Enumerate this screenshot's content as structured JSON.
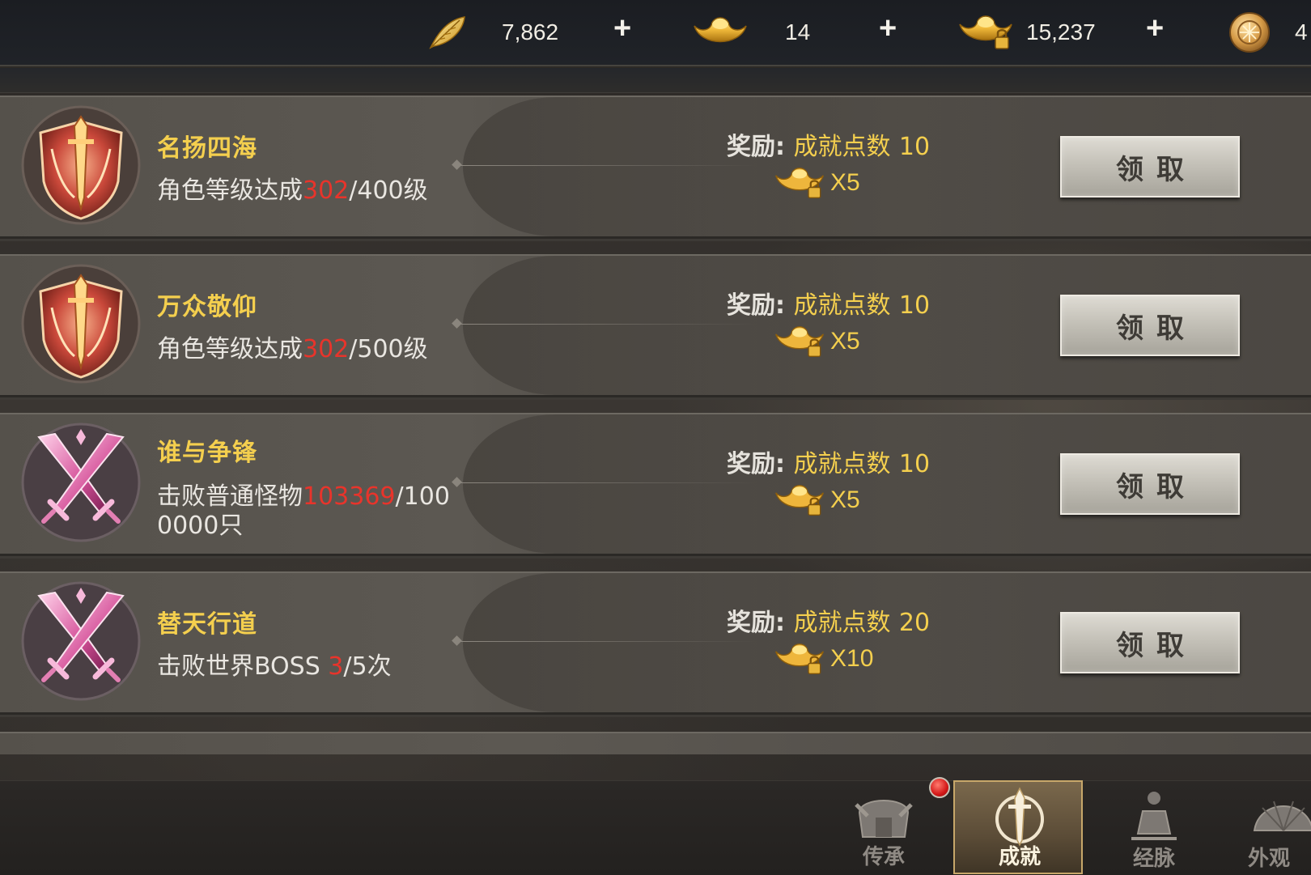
{
  "resources": [
    {
      "icon": "gold-feather-icon",
      "value": "7,862",
      "plus": "+"
    },
    {
      "icon": "gold-ingot-icon",
      "value": "14",
      "plus": "+"
    },
    {
      "icon": "locked-gold-ingot-icon",
      "value": "15,237",
      "plus": "+"
    },
    {
      "icon": "bronze-coin-icon",
      "value": "4"
    }
  ],
  "achievements": [
    {
      "title": "名扬四海",
      "desc_prefix": "角色等级达成",
      "progress": "302",
      "desc_suffix": "/400级",
      "reward_label": "奖励:",
      "reward_text": "成就点数",
      "reward_points": "10",
      "reward_item_icon": "locked-gold-ingot-icon",
      "reward_qty": "X5",
      "emblem": "red-sword-shield-emblem-icon",
      "button": "领取"
    },
    {
      "title": "万众敬仰",
      "desc_prefix": "角色等级达成",
      "progress": "302",
      "desc_suffix": "/500级",
      "reward_label": "奖励:",
      "reward_text": "成就点数",
      "reward_points": "10",
      "reward_item_icon": "locked-gold-ingot-icon",
      "reward_qty": "X5",
      "emblem": "red-sword-shield-emblem-icon",
      "button": "领取"
    },
    {
      "title": "谁与争锋",
      "desc_prefix": "击败普通怪物",
      "progress": "103369",
      "desc_suffix": "/1000000只",
      "reward_label": "奖励:",
      "reward_text": "成就点数",
      "reward_points": "10",
      "reward_item_icon": "locked-gold-ingot-icon",
      "reward_qty": "X5",
      "emblem": "pink-crossed-swords-emblem-icon",
      "button": "领取"
    },
    {
      "title": "替天行道",
      "desc_prefix": "击败世界BOSS ",
      "progress": "3",
      "desc_suffix": "/5次",
      "reward_label": "奖励:",
      "reward_text": "成就点数",
      "reward_points": "20",
      "reward_item_icon": "locked-gold-ingot-icon",
      "reward_qty": "X10",
      "emblem": "pink-crossed-swords-emblem-icon",
      "button": "领取"
    }
  ],
  "tabs": [
    {
      "label": "传承",
      "icon": "helmet-icon",
      "active": false
    },
    {
      "label": "成就",
      "icon": "achievement-sword-icon",
      "active": true
    },
    {
      "label": "经脉",
      "icon": "meridian-figure-icon",
      "active": false
    },
    {
      "label": "外观",
      "icon": "appearance-fan-icon",
      "active": false
    }
  ],
  "colors": {
    "title_gold": "#f4cf4e",
    "progress_red": "#e8342b",
    "tab_active_border": "#c7a76a"
  }
}
